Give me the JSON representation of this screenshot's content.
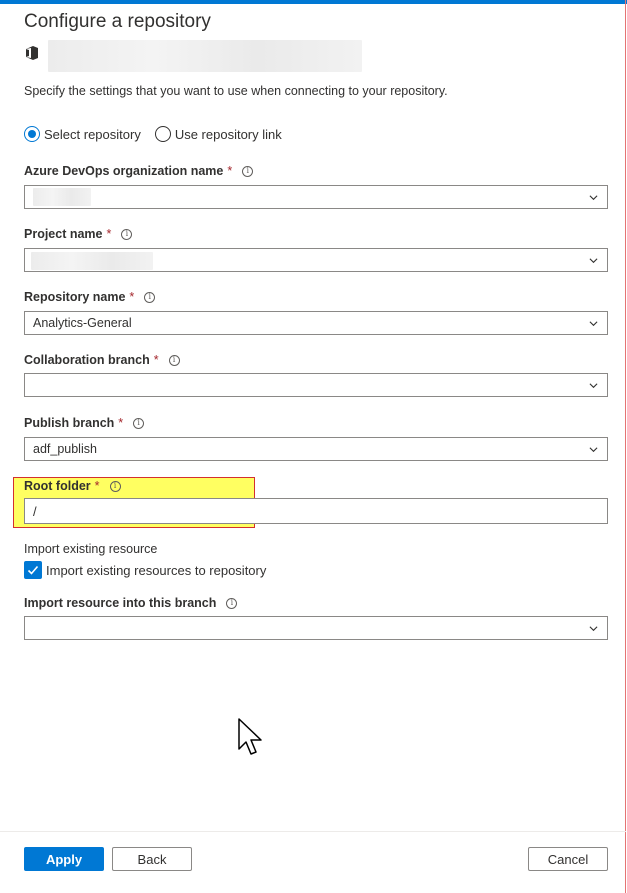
{
  "dialog": {
    "title": "Configure a repository",
    "description": "Specify the settings that you want to use when connecting to your repository."
  },
  "repo_type": {
    "icon": "azure-devops-icon",
    "options": [
      {
        "label": "Select repository",
        "selected": true
      },
      {
        "label": "Use repository link",
        "selected": false
      }
    ]
  },
  "fields": {
    "org": {
      "label": "Azure DevOps organization name",
      "required": "*",
      "value": ""
    },
    "project": {
      "label": "Project name",
      "required": "*",
      "value": ""
    },
    "repository": {
      "label": "Repository name",
      "required": "*",
      "value": "Analytics-General"
    },
    "collab_branch": {
      "label": "Collaboration branch",
      "required": "*",
      "value": ""
    },
    "publish_branch": {
      "label": "Publish branch",
      "required": "*",
      "value": "adf_publish"
    },
    "root_folder": {
      "label": "Root folder",
      "required": "*",
      "value": "/"
    },
    "import_branch": {
      "label": "Import resource into this branch",
      "value": ""
    }
  },
  "import": {
    "section_label": "Import existing resource",
    "checkbox_label": "Import existing resources to repository",
    "checked": true
  },
  "info_glyph": "i",
  "footer": {
    "apply": "Apply",
    "back": "Back",
    "cancel": "Cancel"
  },
  "colors": {
    "accent": "#0078d4",
    "required": "#a4262c",
    "highlight": "#ffff00",
    "highlight_border": "#d32f2f"
  }
}
